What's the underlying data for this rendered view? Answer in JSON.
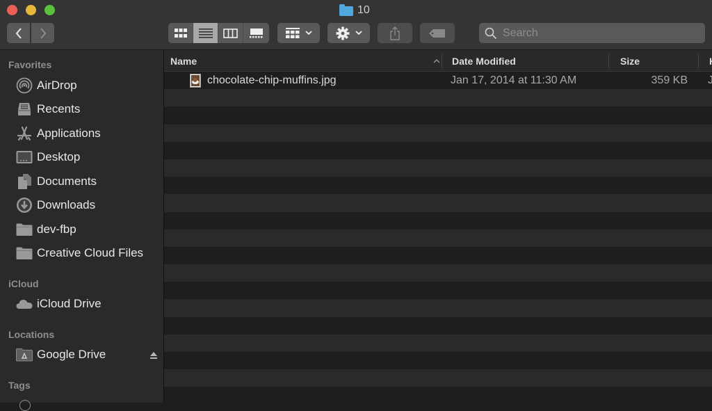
{
  "window": {
    "title": "10",
    "title_icon": "folder-icon"
  },
  "toolbar": {
    "back": "‹",
    "forward": "›",
    "view_modes": [
      {
        "name": "icon-view",
        "active": false
      },
      {
        "name": "list-view",
        "active": true
      },
      {
        "name": "column-view",
        "active": false
      },
      {
        "name": "gallery-view",
        "active": false
      }
    ],
    "group_by_icon": "group-icon",
    "action_icon": "gear-icon",
    "share_icon": "share-icon",
    "tag_icon": "tag-icon",
    "search_placeholder": "Search"
  },
  "sidebar": {
    "favorites_header": "Favorites",
    "favorites": [
      {
        "label": "AirDrop",
        "icon": "airdrop-icon"
      },
      {
        "label": "Recents",
        "icon": "recents-icon"
      },
      {
        "label": "Applications",
        "icon": "applications-icon"
      },
      {
        "label": "Desktop",
        "icon": "desktop-icon"
      },
      {
        "label": "Documents",
        "icon": "documents-icon"
      },
      {
        "label": "Downloads",
        "icon": "downloads-icon"
      },
      {
        "label": "dev-fbp",
        "icon": "folder-icon"
      },
      {
        "label": "Creative Cloud Files",
        "icon": "folder-icon"
      }
    ],
    "icloud_header": "iCloud",
    "icloud": [
      {
        "label": "iCloud Drive",
        "icon": "cloud-icon"
      }
    ],
    "locations_header": "Locations",
    "locations": [
      {
        "label": "Google Drive",
        "icon": "google-drive-icon",
        "ejectable": true
      }
    ],
    "tags_header": "Tags"
  },
  "columns": {
    "name": "Name",
    "date_modified": "Date Modified",
    "size": "Size",
    "kind": "K"
  },
  "files": [
    {
      "name": "chocolate-chip-muffins.jpg",
      "date_modified": "Jan 17, 2014 at 11:30 AM",
      "size": "359 KB",
      "kind": "J"
    }
  ]
}
